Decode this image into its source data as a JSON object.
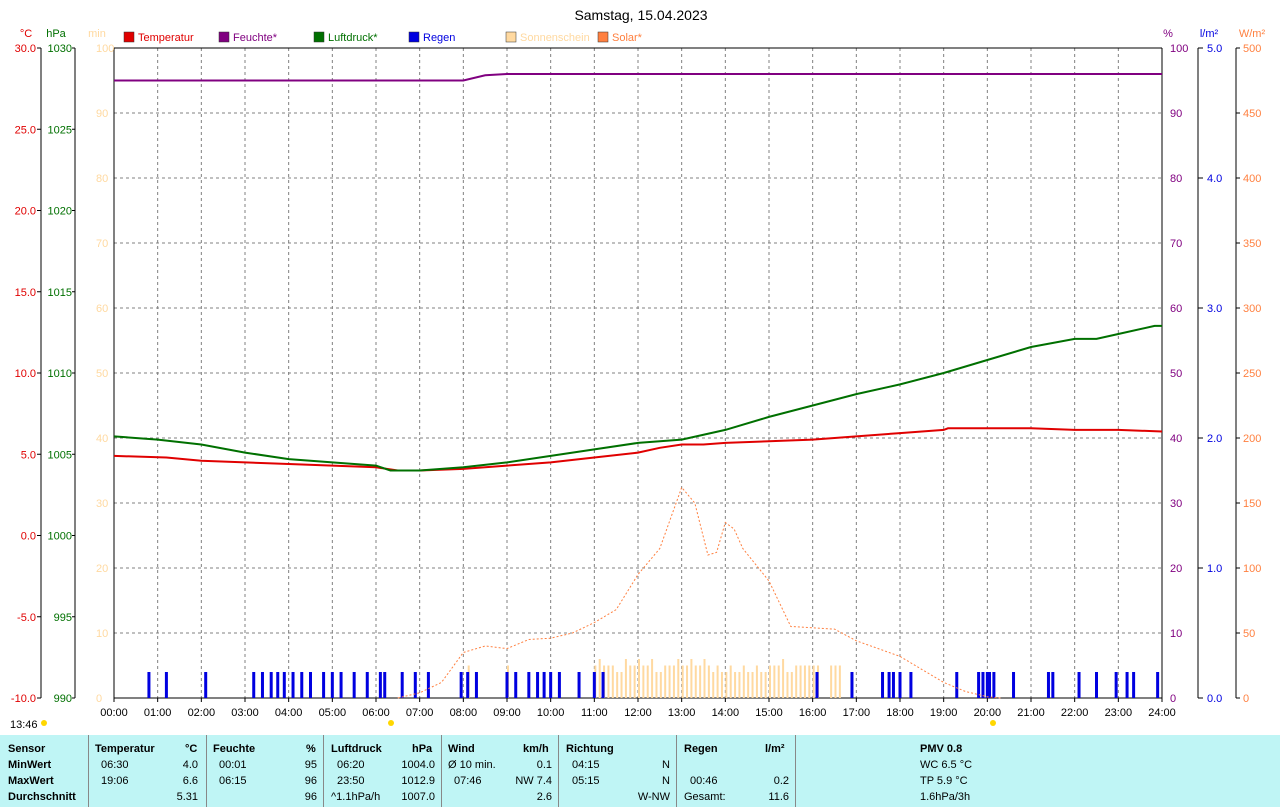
{
  "title": "Samstag, 15.04.2023",
  "axes": {
    "temp_unit": "°C",
    "press_unit": "hPa",
    "sun_unit": "min",
    "hum_unit": "%",
    "rain_unit": "l/m²",
    "solar_unit": "W/m²",
    "temp_ticks": [
      "30.0",
      "25.0",
      "20.0",
      "15.0",
      "10.0",
      "5.0",
      "0.0",
      "-5.0",
      "-10.0"
    ],
    "press_ticks": [
      "1030",
      "1025",
      "1020",
      "1015",
      "1010",
      "1005",
      "1000",
      "995",
      "990"
    ],
    "sun_ticks": [
      "100",
      "90",
      "80",
      "70",
      "60",
      "50",
      "40",
      "30",
      "20",
      "10",
      "0"
    ],
    "hum_ticks": [
      "100",
      "90",
      "80",
      "70",
      "60",
      "50",
      "40",
      "30",
      "20",
      "10",
      "0"
    ],
    "rain_ticks": [
      "5.0",
      "4.0",
      "3.0",
      "2.0",
      "1.0",
      "0.0"
    ],
    "solar_ticks": [
      "500",
      "450",
      "400",
      "350",
      "300",
      "250",
      "200",
      "150",
      "100",
      "50",
      "0"
    ],
    "x_ticks": [
      "00:00",
      "01:00",
      "02:00",
      "03:00",
      "04:00",
      "05:00",
      "06:00",
      "07:00",
      "08:00",
      "09:00",
      "10:00",
      "11:00",
      "12:00",
      "13:00",
      "14:00",
      "15:00",
      "16:00",
      "17:00",
      "18:00",
      "19:00",
      "20:00",
      "21:00",
      "22:00",
      "23:00",
      "24:00"
    ]
  },
  "legend": [
    {
      "label": "Temperatur",
      "color": "#e00000",
      "text_color": "#e00000"
    },
    {
      "label": "Feuchte*",
      "color": "#800080",
      "text_color": "#800080"
    },
    {
      "label": "Luftdruck*",
      "color": "#007000",
      "text_color": "#007000"
    },
    {
      "label": "Regen",
      "color": "#0000e0",
      "text_color": "#0000e0"
    },
    {
      "label": "Sonnenschein",
      "color": "#ffd9a0",
      "text_color": "#ffd9a0"
    },
    {
      "label": "Solar*",
      "color": "#ff8040",
      "text_color": "#ff8040"
    }
  ],
  "colors": {
    "temp": "#e00000",
    "hum": "#800080",
    "press": "#007000",
    "rain": "#0000e0",
    "sun": "#ffd9a0",
    "solar": "#ff8040",
    "grid": "#808080"
  },
  "time_stamp": "13:46",
  "chart_data": {
    "type": "line",
    "x_range_hours": [
      0,
      24
    ],
    "series": [
      {
        "name": "Temperatur",
        "axis": "°C",
        "ylim": [
          -10,
          30
        ],
        "points": [
          [
            0,
            4.9
          ],
          [
            1.2,
            4.8
          ],
          [
            2,
            4.6
          ],
          [
            3,
            4.5
          ],
          [
            4,
            4.4
          ],
          [
            5,
            4.3
          ],
          [
            6,
            4.2
          ],
          [
            6.5,
            4.0
          ],
          [
            7,
            4.0
          ],
          [
            8,
            4.1
          ],
          [
            9,
            4.3
          ],
          [
            10,
            4.5
          ],
          [
            11,
            4.8
          ],
          [
            12,
            5.1
          ],
          [
            12.5,
            5.4
          ],
          [
            13,
            5.6
          ],
          [
            13.5,
            5.6
          ],
          [
            14,
            5.7
          ],
          [
            15,
            5.8
          ],
          [
            16,
            5.9
          ],
          [
            17,
            6.1
          ],
          [
            18,
            6.3
          ],
          [
            19,
            6.5
          ],
          [
            19.1,
            6.6
          ],
          [
            20,
            6.6
          ],
          [
            21,
            6.6
          ],
          [
            22,
            6.5
          ],
          [
            23,
            6.5
          ],
          [
            24,
            6.4
          ]
        ]
      },
      {
        "name": "Feuchte*",
        "axis": "%",
        "ylim": [
          0,
          100
        ],
        "points": [
          [
            0,
            95
          ],
          [
            6,
            95
          ],
          [
            8,
            95
          ],
          [
            8.5,
            95.8
          ],
          [
            9,
            96
          ],
          [
            24,
            96
          ]
        ]
      },
      {
        "name": "Luftdruck*",
        "axis": "hPa",
        "ylim": [
          990,
          1030
        ],
        "points": [
          [
            0,
            1006.1
          ],
          [
            1,
            1005.9
          ],
          [
            2,
            1005.6
          ],
          [
            3,
            1005.1
          ],
          [
            4,
            1004.7
          ],
          [
            5,
            1004.5
          ],
          [
            6,
            1004.3
          ],
          [
            6.33,
            1004.0
          ],
          [
            7,
            1004.0
          ],
          [
            8,
            1004.2
          ],
          [
            9,
            1004.5
          ],
          [
            10,
            1004.9
          ],
          [
            11,
            1005.3
          ],
          [
            12,
            1005.7
          ],
          [
            13,
            1005.9
          ],
          [
            14,
            1006.5
          ],
          [
            15,
            1007.3
          ],
          [
            16,
            1008.0
          ],
          [
            17,
            1008.7
          ],
          [
            18,
            1009.3
          ],
          [
            19,
            1010.0
          ],
          [
            20,
            1010.8
          ],
          [
            21,
            1011.6
          ],
          [
            22,
            1012.1
          ],
          [
            22.5,
            1012.1
          ],
          [
            23,
            1012.4
          ],
          [
            23.83,
            1012.9
          ],
          [
            24,
            1012.9
          ]
        ]
      },
      {
        "name": "Solar*",
        "axis": "W/m²",
        "ylim": [
          0,
          500
        ],
        "points": [
          [
            6.5,
            0
          ],
          [
            7,
            4
          ],
          [
            7.5,
            12
          ],
          [
            8,
            35
          ],
          [
            8.5,
            40
          ],
          [
            9,
            38
          ],
          [
            9.5,
            45
          ],
          [
            10,
            46
          ],
          [
            10.5,
            50
          ],
          [
            11,
            58
          ],
          [
            11.5,
            68
          ],
          [
            12,
            95
          ],
          [
            12.5,
            115
          ],
          [
            13,
            162
          ],
          [
            13.3,
            150
          ],
          [
            13.6,
            110
          ],
          [
            13.8,
            112
          ],
          [
            14,
            135
          ],
          [
            14.2,
            130
          ],
          [
            14.4,
            115
          ],
          [
            15,
            90
          ],
          [
            15.5,
            55
          ],
          [
            16,
            54
          ],
          [
            16.5,
            53
          ],
          [
            17,
            44
          ],
          [
            17.5,
            38
          ],
          [
            18,
            32
          ],
          [
            18.5,
            22
          ],
          [
            19,
            12
          ],
          [
            19.5,
            5
          ],
          [
            20,
            1
          ],
          [
            20.3,
            0
          ]
        ]
      }
    ],
    "sun_minutes": {
      "axis": "min",
      "ylim": [
        0,
        100
      ],
      "hours": [
        11,
        11.33,
        11.67,
        12,
        12.33,
        12.67,
        13,
        13.33,
        13.67,
        14,
        14.33,
        14.67,
        15,
        15.33,
        15.67
      ],
      "height": [
        6,
        5,
        6,
        6,
        5,
        6,
        6,
        6,
        5,
        5,
        5,
        5,
        6,
        5,
        6
      ]
    },
    "rain_bars_hours": [
      0.8,
      1.2,
      2.1,
      3.2,
      3.4,
      3.6,
      3.75,
      3.9,
      4.1,
      4.3,
      4.5,
      4.8,
      5.0,
      5.2,
      5.5,
      5.8,
      6.1,
      6.2,
      6.6,
      6.9,
      7.2,
      7.95,
      8.1,
      8.3,
      9.0,
      9.2,
      9.5,
      9.7,
      9.85,
      10.0,
      10.2,
      10.65,
      11.0,
      11.2,
      16.1,
      16.9,
      17.6,
      17.75,
      17.85,
      18.0,
      18.25,
      19.3,
      19.8,
      19.9,
      20.0,
      20.05,
      20.15,
      20.6,
      21.4,
      21.5,
      22.1,
      22.5,
      22.95,
      23.2,
      23.35,
      23.9
    ],
    "rain_bar_height": 0.2
  },
  "table": {
    "cols": [
      {
        "head": "Sensor",
        "rows": [
          "MinWert",
          "MaxWert",
          "Durchschnitt"
        ]
      },
      {
        "head": "Temperatur",
        "unit": "°C",
        "time": [
          "06:30",
          "19:06",
          ""
        ],
        "val": [
          "4.0",
          "6.6",
          "5.31"
        ]
      },
      {
        "head": "Feuchte",
        "unit": "%",
        "time": [
          "00:01",
          "06:15",
          ""
        ],
        "val": [
          "95",
          "96",
          "96"
        ]
      },
      {
        "head": "Luftdruck",
        "unit": "hPa",
        "time": [
          "06:20",
          "23:50",
          "^1.1hPa/h"
        ],
        "val": [
          "1004.0",
          "1012.9",
          "1007.0"
        ]
      },
      {
        "head": "Wind",
        "unit": "km/h",
        "time": [
          "Ø 10 min.",
          "07:46",
          ""
        ],
        "val": [
          "0.1",
          "NW 7.4",
          "2.6"
        ]
      },
      {
        "head": "Richtung",
        "time": [
          "04:15",
          "05:15",
          ""
        ],
        "val": [
          "N",
          "N",
          "W-NW"
        ]
      },
      {
        "head": "Regen",
        "unit": "l/m²",
        "time": [
          "",
          "00:46",
          "Gesamt:"
        ],
        "val": [
          "",
          "0.2",
          "11.6"
        ]
      },
      {
        "head": "PMV 0.8",
        "rows": [
          "WC 6.5 °C",
          "TP 5.9 °C",
          "1.6hPa/3h"
        ]
      }
    ]
  }
}
